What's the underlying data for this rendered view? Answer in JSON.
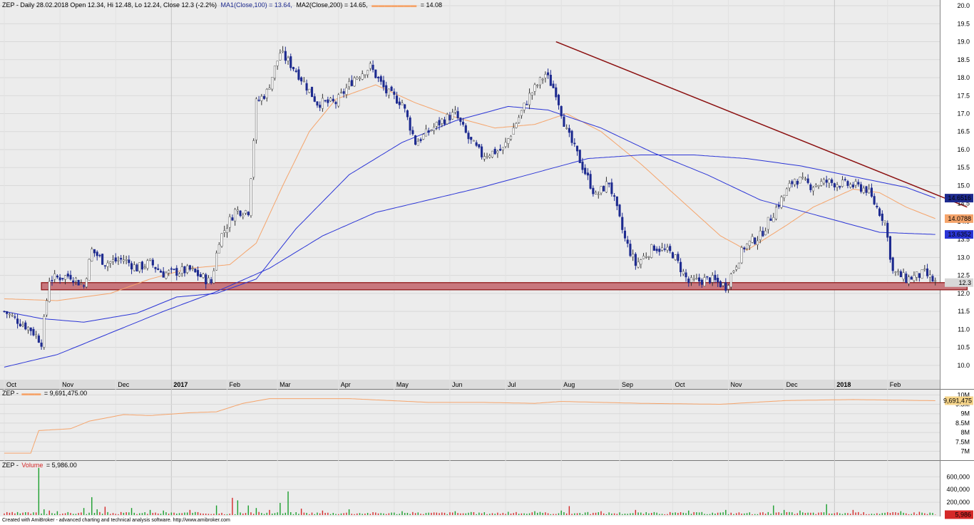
{
  "header": {
    "symbol": "ZEP",
    "info": "ZEP - Daily 28.02.2018 Open 12.34, Hi 12.48, Lo 12.24, Close 12.3 (-2.2%)",
    "ma1": "MA1(Close,100) = 13.64,",
    "ma2": "MA2(Close,200) = 14.65,",
    "ma3_value": "= 14.08"
  },
  "obv_panel": {
    "title": "ZEP -",
    "value": "= 9,691,475.00"
  },
  "volume_panel": {
    "title": "ZEP -",
    "series_name": "Volume",
    "value": "= 5,986.00"
  },
  "footer": "Created with AmiBroker - advanced charting and technical analysis software. http://www.amibroker.com",
  "colors": {
    "background": "#ececec",
    "candle_up": "#ffffff",
    "candle_down": "#1d2a8f",
    "ma_blue": "#2b35d6",
    "ma_orange": "#f5a46b",
    "trendline": "#8b1010",
    "support_zone": "#c8777d",
    "volume_up": "#1a9e2c",
    "volume_down": "#d42828"
  },
  "chart_data": [
    {
      "type": "candlestick",
      "panel": "price",
      "ylim": [
        9.7,
        20.1
      ],
      "y_ticks": [
        10.0,
        10.5,
        11.0,
        11.5,
        12.0,
        12.5,
        13.0,
        13.5,
        14.0,
        14.5,
        15.0,
        15.5,
        16.0,
        16.5,
        17.0,
        17.5,
        18.0,
        18.5,
        19.0,
        19.5,
        20.0
      ],
      "x_labels": [
        "Oct",
        "Nov",
        "Dec",
        "2017",
        "Feb",
        "Mar",
        "Apr",
        "May",
        "Jun",
        "Jul",
        "Aug",
        "Sep",
        "Oct",
        "Nov",
        "Dec",
        "2018",
        "Feb"
      ],
      "x_label_bars": [
        0,
        21,
        42,
        63,
        84,
        103,
        126,
        147,
        168,
        189,
        210,
        232,
        252,
        273,
        294,
        313,
        333
      ],
      "bar_count": 352,
      "price_path": [
        [
          0,
          11.5
        ],
        [
          10,
          11.0
        ],
        [
          14,
          10.65
        ],
        [
          17,
          12.4
        ],
        [
          25,
          12.5
        ],
        [
          30,
          12.2
        ],
        [
          33,
          13.2
        ],
        [
          38,
          12.85
        ],
        [
          45,
          12.95
        ],
        [
          50,
          12.7
        ],
        [
          55,
          12.85
        ],
        [
          60,
          12.55
        ],
        [
          70,
          12.65
        ],
        [
          78,
          12.3
        ],
        [
          81,
          13.5
        ],
        [
          87,
          14.3
        ],
        [
          92,
          14.3
        ],
        [
          95,
          17.3
        ],
        [
          99,
          17.6
        ],
        [
          104,
          18.7
        ],
        [
          110,
          18.2
        ],
        [
          118,
          17.3
        ],
        [
          125,
          17.3
        ],
        [
          132,
          18.0
        ],
        [
          138,
          18.3
        ],
        [
          144,
          17.6
        ],
        [
          150,
          17.3
        ],
        [
          155,
          16.2
        ],
        [
          160,
          16.5
        ],
        [
          165,
          16.8
        ],
        [
          170,
          17.0
        ],
        [
          175,
          16.3
        ],
        [
          180,
          15.85
        ],
        [
          188,
          16.0
        ],
        [
          198,
          17.5
        ],
        [
          204,
          18.1
        ],
        [
          208,
          17.6
        ],
        [
          212,
          16.5
        ],
        [
          217,
          15.7
        ],
        [
          223,
          14.7
        ],
        [
          228,
          15.1
        ],
        [
          234,
          13.5
        ],
        [
          238,
          12.8
        ],
        [
          245,
          13.3
        ],
        [
          252,
          13.1
        ],
        [
          258,
          12.3
        ],
        [
          266,
          12.4
        ],
        [
          272,
          12.2
        ],
        [
          279,
          13.3
        ],
        [
          285,
          13.6
        ],
        [
          292,
          14.5
        ],
        [
          298,
          15.2
        ],
        [
          304,
          15.0
        ],
        [
          310,
          15.1
        ],
        [
          320,
          15.0
        ],
        [
          325,
          14.9
        ],
        [
          332,
          14.0
        ],
        [
          335,
          12.6
        ],
        [
          340,
          12.4
        ],
        [
          347,
          12.55
        ],
        [
          351,
          12.3
        ]
      ],
      "ma1_label": "MA1(Close,100) = 13.64,",
      "ma1_path": [
        [
          0,
          11.5
        ],
        [
          14,
          11.3
        ],
        [
          30,
          11.2
        ],
        [
          50,
          11.45
        ],
        [
          65,
          11.9
        ],
        [
          80,
          12.0
        ],
        [
          95,
          12.4
        ],
        [
          110,
          13.8
        ],
        [
          130,
          15.3
        ],
        [
          150,
          16.2
        ],
        [
          170,
          16.8
        ],
        [
          190,
          17.2
        ],
        [
          205,
          17.1
        ],
        [
          225,
          16.6
        ],
        [
          245,
          15.9
        ],
        [
          265,
          15.3
        ],
        [
          285,
          14.6
        ],
        [
          300,
          14.3
        ],
        [
          315,
          14.0
        ],
        [
          330,
          13.7
        ],
        [
          351,
          13.64
        ]
      ],
      "ma2_label": "MA2(Close,200) = 14.65,",
      "ma2_path": [
        [
          0,
          9.95
        ],
        [
          20,
          10.3
        ],
        [
          40,
          10.9
        ],
        [
          60,
          11.5
        ],
        [
          80,
          12.05
        ],
        [
          100,
          12.7
        ],
        [
          120,
          13.6
        ],
        [
          140,
          14.25
        ],
        [
          160,
          14.6
        ],
        [
          180,
          14.95
        ],
        [
          200,
          15.35
        ],
        [
          220,
          15.75
        ],
        [
          240,
          15.85
        ],
        [
          260,
          15.85
        ],
        [
          280,
          15.75
        ],
        [
          300,
          15.55
        ],
        [
          320,
          15.25
        ],
        [
          340,
          14.95
        ],
        [
          351,
          14.65
        ]
      ],
      "ma3_value": "14.08",
      "ma3_path": [
        [
          0,
          11.85
        ],
        [
          20,
          11.8
        ],
        [
          40,
          12.0
        ],
        [
          55,
          12.4
        ],
        [
          70,
          12.7
        ],
        [
          85,
          12.8
        ],
        [
          95,
          13.4
        ],
        [
          105,
          15.0
        ],
        [
          115,
          16.5
        ],
        [
          125,
          17.4
        ],
        [
          140,
          17.8
        ],
        [
          155,
          17.3
        ],
        [
          170,
          16.9
        ],
        [
          185,
          16.6
        ],
        [
          200,
          16.7
        ],
        [
          212,
          17.0
        ],
        [
          225,
          16.5
        ],
        [
          240,
          15.6
        ],
        [
          255,
          14.6
        ],
        [
          270,
          13.6
        ],
        [
          280,
          13.2
        ],
        [
          295,
          13.9
        ],
        [
          305,
          14.4
        ],
        [
          320,
          14.9
        ],
        [
          330,
          14.8
        ],
        [
          340,
          14.4
        ],
        [
          351,
          14.08
        ]
      ],
      "trendline": [
        [
          208,
          19.0
        ],
        [
          363,
          14.4
        ]
      ],
      "support_zone": {
        "from_bar": 14,
        "to_bar": 363,
        "low": 12.1,
        "high": 12.3
      },
      "axis_markers": [
        {
          "label": "14.6516",
          "value": 14.65,
          "color": "#1d2a8f",
          "text_color": "#ffffff"
        },
        {
          "label": "14.0788",
          "value": 14.08,
          "color": "#f5a46b",
          "text_color": "#000000"
        },
        {
          "label": "13.6352",
          "value": 13.64,
          "color": "#2b35d6",
          "text_color": "#ffffff"
        },
        {
          "label": "12.3",
          "value": 12.3,
          "color": "#d8d8d8",
          "text_color": "#000000"
        }
      ]
    },
    {
      "type": "line",
      "panel": "obv",
      "ylim": [
        6.6,
        10.05
      ],
      "y_ticks": [
        "10M",
        "9.5M",
        "9M",
        "8.5M",
        "8M",
        "7.5M",
        "7M"
      ],
      "y_tick_values": [
        10.0,
        9.5,
        9.0,
        8.5,
        8.0,
        7.5,
        7.0
      ],
      "value_label": "9,691,475",
      "path": [
        [
          0,
          6.9
        ],
        [
          10,
          6.9
        ],
        [
          13,
          8.1
        ],
        [
          25,
          8.2
        ],
        [
          32,
          8.6
        ],
        [
          45,
          8.95
        ],
        [
          55,
          8.9
        ],
        [
          70,
          9.05
        ],
        [
          80,
          9.1
        ],
        [
          90,
          9.55
        ],
        [
          100,
          9.8
        ],
        [
          115,
          9.8
        ],
        [
          130,
          9.8
        ],
        [
          160,
          9.6
        ],
        [
          180,
          9.6
        ],
        [
          200,
          9.55
        ],
        [
          210,
          9.65
        ],
        [
          240,
          9.55
        ],
        [
          270,
          9.5
        ],
        [
          295,
          9.7
        ],
        [
          320,
          9.75
        ],
        [
          351,
          9.69
        ]
      ]
    },
    {
      "type": "bar",
      "panel": "volume",
      "series_name": "Volume",
      "ylim": [
        0,
        760000
      ],
      "y_ticks": [
        "600,000",
        "400,000",
        "200,000"
      ],
      "y_tick_values": [
        600000,
        400000,
        200000
      ],
      "value_label": "5,986",
      "bars": [
        [
          13,
          740000,
          "up"
        ],
        [
          15,
          90000,
          "up"
        ],
        [
          17,
          70000,
          "down"
        ],
        [
          20,
          60000,
          "up"
        ],
        [
          30,
          110000,
          "up"
        ],
        [
          33,
          280000,
          "up"
        ],
        [
          35,
          90000,
          "up"
        ],
        [
          38,
          130000,
          "down"
        ],
        [
          48,
          110000,
          "up"
        ],
        [
          55,
          80000,
          "up"
        ],
        [
          60,
          70000,
          "up"
        ],
        [
          70,
          80000,
          "down"
        ],
        [
          80,
          150000,
          "up"
        ],
        [
          86,
          270000,
          "down"
        ],
        [
          88,
          230000,
          "up"
        ],
        [
          92,
          150000,
          "up"
        ],
        [
          95,
          110000,
          "up"
        ],
        [
          100,
          80000,
          "down"
        ],
        [
          104,
          190000,
          "up"
        ],
        [
          107,
          370000,
          "up"
        ],
        [
          112,
          100000,
          "down"
        ],
        [
          120,
          70000,
          "down"
        ],
        [
          130,
          90000,
          "up"
        ],
        [
          150,
          60000,
          "up"
        ],
        [
          170,
          60000,
          "up"
        ],
        [
          190,
          50000,
          "up"
        ],
        [
          200,
          60000,
          "up"
        ],
        [
          210,
          70000,
          "up"
        ],
        [
          213,
          140000,
          "down"
        ],
        [
          225,
          60000,
          "down"
        ],
        [
          238,
          80000,
          "down"
        ],
        [
          258,
          70000,
          "up"
        ],
        [
          272,
          80000,
          "up"
        ],
        [
          290,
          150000,
          "up"
        ],
        [
          294,
          80000,
          "up"
        ],
        [
          300,
          70000,
          "up"
        ],
        [
          310,
          170000,
          "up"
        ],
        [
          320,
          80000,
          "down"
        ],
        [
          338,
          60000,
          "up"
        ],
        [
          345,
          50000,
          "down"
        ],
        [
          351,
          6000,
          "down"
        ]
      ],
      "small_volume_level": 40000
    }
  ]
}
